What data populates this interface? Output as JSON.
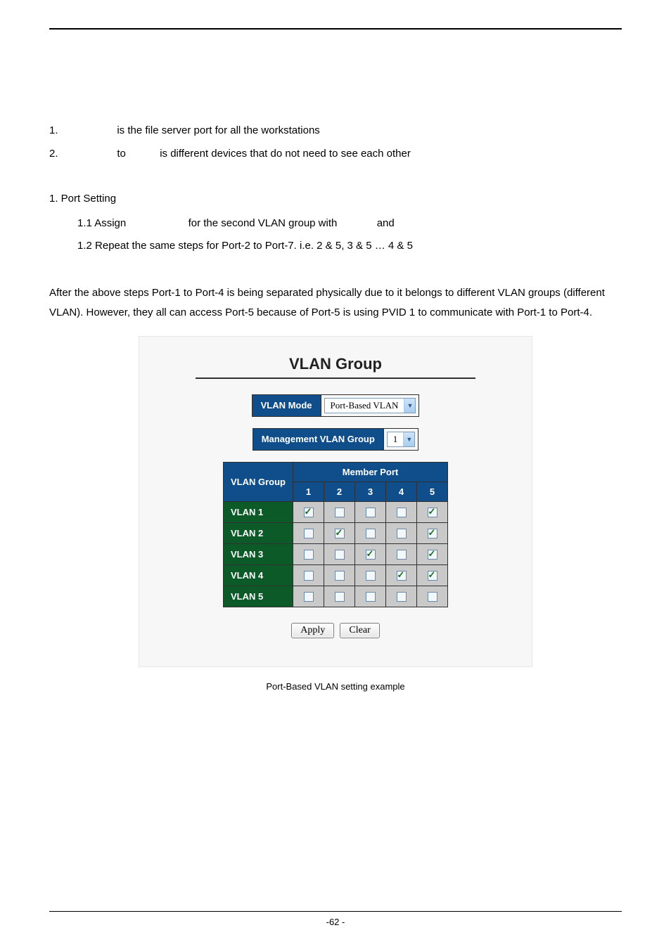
{
  "lines": {
    "l1_num": "1.",
    "l1_text": "is the file server port for all the workstations",
    "l2_num": "2.",
    "l2_mid": "to",
    "l2_text": "is different devices that do not need to see each other"
  },
  "setup": {
    "heading": "1. Port Setting",
    "s1_lead": "1.1 Assign",
    "s1_mid": "for the second VLAN group with",
    "s1_tail": "and",
    "s2": "1.2 Repeat the same steps for Port-2 to Port-7. i.e. 2 & 5, 3 & 5 … 4 & 5"
  },
  "para": "After the above steps Port-1 to Port-4 is being separated physically due to it belongs to different VLAN groups (different VLAN). However, they all can access Port-5 because of Port-5 is using PVID 1 to communicate with Port-1 to Port-4.",
  "panel": {
    "title": "VLAN Group",
    "mode_label": "VLAN Mode",
    "mode_value": "Port-Based VLAN",
    "mgmt_label": "Management VLAN Group",
    "mgmt_value": "1",
    "table": {
      "group_header": "VLAN Group",
      "member_header": "Member Port",
      "cols": [
        "1",
        "2",
        "3",
        "4",
        "5"
      ],
      "rows": [
        {
          "name": "VLAN 1",
          "vals": [
            true,
            false,
            false,
            false,
            true
          ]
        },
        {
          "name": "VLAN 2",
          "vals": [
            false,
            true,
            false,
            false,
            true
          ]
        },
        {
          "name": "VLAN 3",
          "vals": [
            false,
            false,
            true,
            false,
            true
          ]
        },
        {
          "name": "VLAN 4",
          "vals": [
            false,
            false,
            false,
            true,
            true
          ]
        },
        {
          "name": "VLAN 5",
          "vals": [
            false,
            false,
            false,
            false,
            false
          ]
        }
      ]
    },
    "apply": "Apply",
    "clear": "Clear"
  },
  "caption": "Port-Based VLAN setting example",
  "page_number": "-62 -"
}
